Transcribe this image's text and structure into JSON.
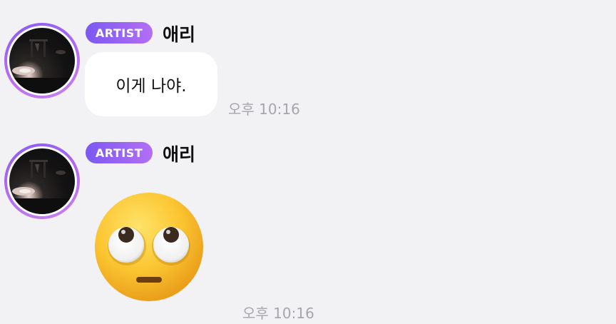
{
  "messages": [
    {
      "badge": "ARTIST",
      "name": "애리",
      "text": "이게 나야.",
      "time": "오후 10:16"
    },
    {
      "badge": "ARTIST",
      "name": "애리",
      "emoji": "face-with-rolling-eyes",
      "time": "오후 10:16"
    }
  ],
  "colors": {
    "background": "#f2f2f4",
    "badge_start": "#7b59f2",
    "badge_end": "#b46ef5",
    "bubble": "#ffffff",
    "time_text": "#a6a6ab"
  }
}
